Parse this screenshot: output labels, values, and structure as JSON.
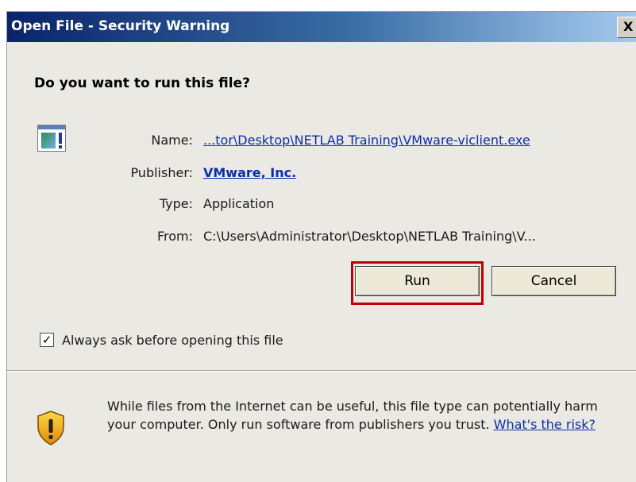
{
  "window": {
    "title": "Open File - Security Warning",
    "close_glyph": "X"
  },
  "prompt": {
    "heading": "Do you want to run this file?"
  },
  "file_info": {
    "name_label": "Name:",
    "name_value": "...tor\\Desktop\\NETLAB Training\\VMware-viclient.exe",
    "publisher_label": "Publisher:",
    "publisher_value": "VMware, Inc.",
    "type_label": "Type:",
    "type_value": "Application",
    "from_label": "From:",
    "from_value": "C:\\Users\\Administrator\\Desktop\\NETLAB Training\\V..."
  },
  "buttons": {
    "run": "Run",
    "cancel": "Cancel"
  },
  "option": {
    "always_ask_label": "Always ask before opening this file",
    "always_ask_checked": true,
    "check_glyph": "✓"
  },
  "warning": {
    "text": "While files from the Internet can be useful, this file type can potentially harm your computer. Only run software from publishers you trust.",
    "risk_link": "What's the risk?"
  },
  "colors": {
    "dialog_bg": "#ebe9e4",
    "title_bar_start": "#0a246a",
    "link": "#0b2ea8",
    "highlight": "#c00000"
  },
  "icons": {
    "file": "application-file-icon",
    "shield": "warning-shield-icon",
    "close": "close-icon"
  }
}
